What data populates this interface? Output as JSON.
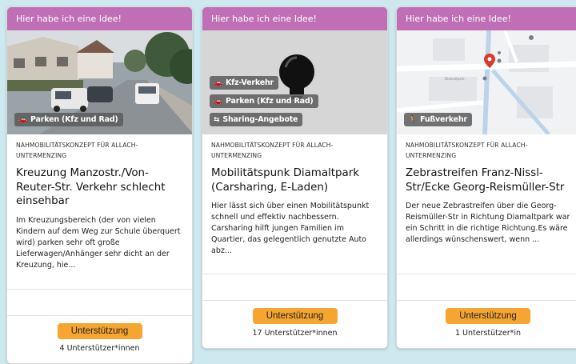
{
  "cards": [
    {
      "banner": "Hier habe ich eine Idee!",
      "tags": [
        "Parken (Kfz und Rad)"
      ],
      "category": "NAHMOBILITÄTSKONZEPT FÜR ALLACH-UNTERMENZING",
      "title": "Kreuzung Manzostr./Von-Reuter-Str. Verkehr schlecht einsehbar",
      "description": "Im Kreuzungsbereich (der von vielen Kindern auf dem Weg zur Schule überquert wird) parken sehr oft große Lieferwagen/Anhänger sehr dicht an der Kreuzung, hie...",
      "button": "Unterstützung",
      "supporters": "4 Unterstützer*innen"
    },
    {
      "banner": "Hier habe ich eine Idee!",
      "tags": [
        "Kfz-Verkehr",
        "Parken (Kfz und Rad)",
        "Sharing-Angebote"
      ],
      "category": "NAHMOBILITÄTSKONZEPT FÜR ALLACH-UNTERMENZING",
      "title": "Mobilitätspunk Diamaltpark (Carsharing, E-Laden)",
      "description": "Hier lässt sich über einen Mobilitätspunkt schnell und effektiv nachbessern. Carsharing hilft jungen Familien im Quartier, das gelegentlich genutzte Auto abz...",
      "button": "Unterstützung",
      "supporters": "17 Unterstützer*innen"
    },
    {
      "banner": "Hier habe ich eine Idee!",
      "tags": [
        "Fußverkehr"
      ],
      "category": "NAHMOBILITÄTSKONZEPT FÜR ALLACH-UNTERMENZING",
      "title": "Zebrastreifen Franz-Nissl-Str/Ecke Georg-Reismüller-Str",
      "description": "Der neue Zebrastreifen über die Georg-Reismüller-Str in Richtung Diamaltpark war ein Schritt in die richtige Richtung.Es wäre allerdings wünschenswert, wenn ...",
      "button": "Unterstützung",
      "supporters": "1 Unterstützer*in"
    }
  ],
  "colors": {
    "background": "#cde9ef",
    "banner": "#c06fb6",
    "button": "#f7a531",
    "tag": "#5a5a5a"
  },
  "icons": {
    "parking": "car-icon",
    "traffic": "car-icon",
    "sharing": "sharing-icon",
    "walking": "pedestrian-icon",
    "idea": "lightbulb-icon",
    "map_pin": "map-pin-icon"
  }
}
